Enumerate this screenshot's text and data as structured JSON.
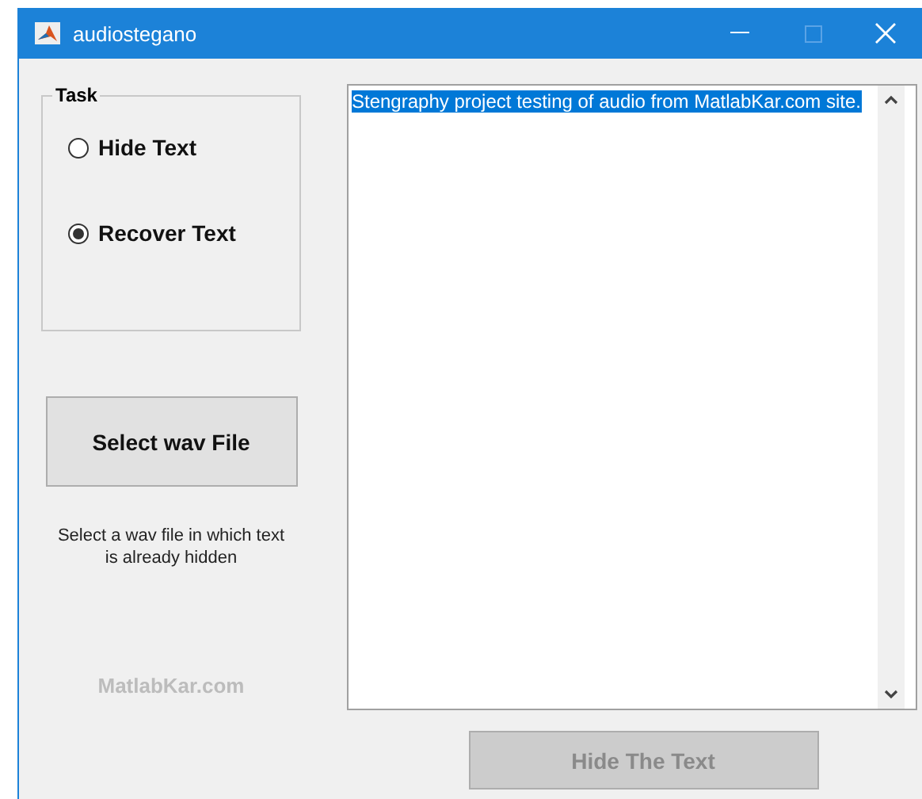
{
  "window": {
    "title": "audiostegano"
  },
  "task": {
    "title": "Task",
    "options": [
      {
        "label": "Hide Text",
        "selected": false
      },
      {
        "label": "Recover Text",
        "selected": true
      }
    ]
  },
  "select_button": {
    "label": "Select wav File",
    "disabled": false
  },
  "hint": "Select a wav file in which text is already hidden",
  "brand": "MatlabKar.com",
  "text_area": {
    "value": "Stengraphy project testing of audio from MatlabKar.com site.",
    "selected": true
  },
  "hide_button": {
    "label": "Hide The Text",
    "disabled": true
  }
}
